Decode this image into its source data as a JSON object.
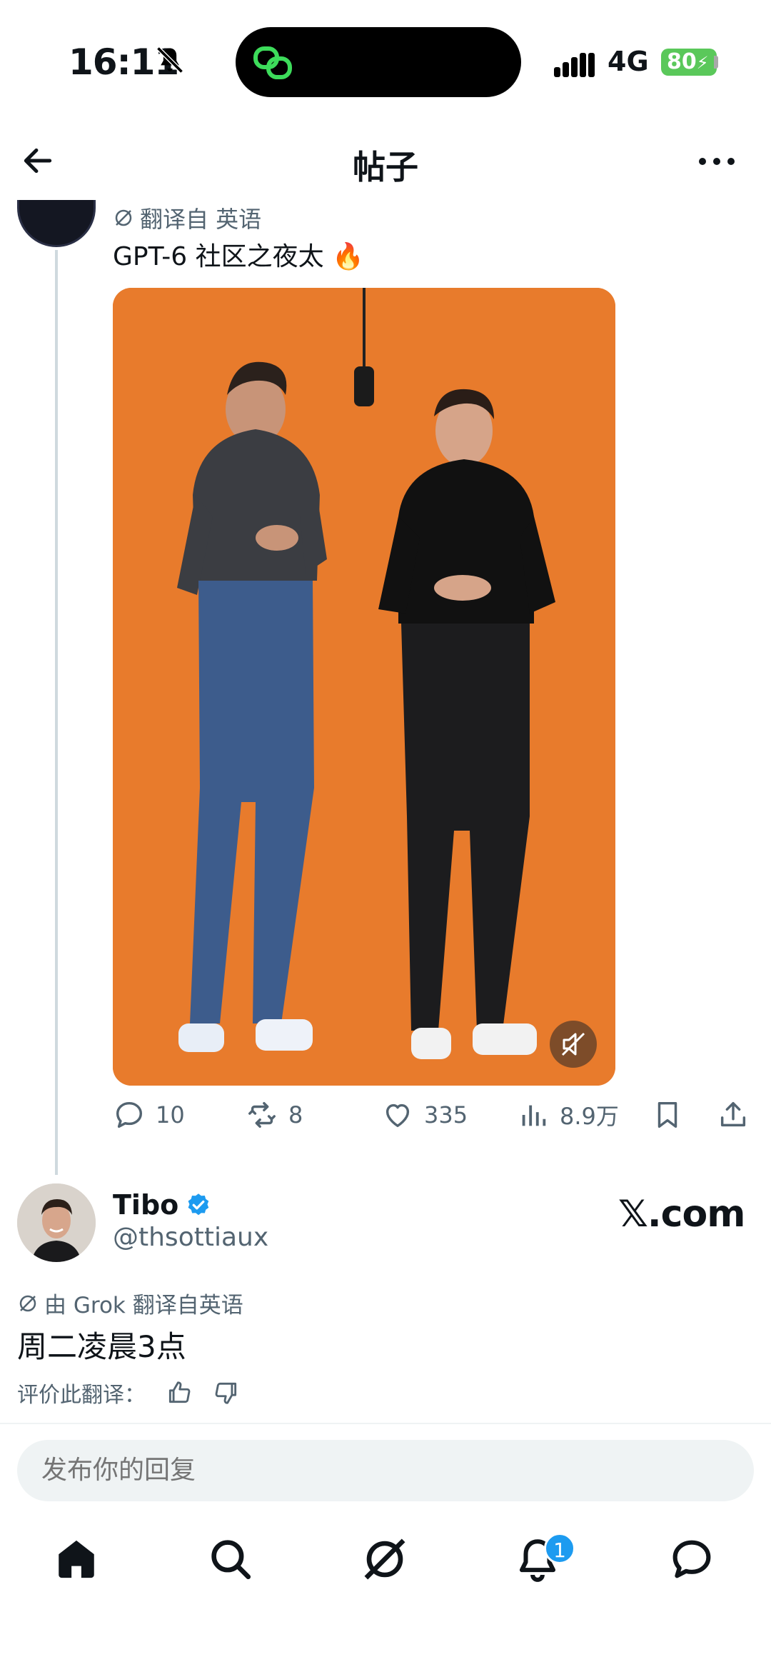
{
  "status_bar": {
    "time": "16:11",
    "network": "4G",
    "battery": "80"
  },
  "header": {
    "title": "帖子"
  },
  "post": {
    "translation_label": "翻译自 英语",
    "text": "GPT-6 社区之夜太 🔥",
    "stats": {
      "replies": "10",
      "reposts": "8",
      "likes": "335",
      "views": "8.9万"
    }
  },
  "reply": {
    "name": "Tibo",
    "handle": "@thsottiaux",
    "badge_text": "𝕏.com",
    "translation_label": "由 Grok 翻译自英语",
    "text": "周二凌晨3点",
    "rate_label": "评价此翻译："
  },
  "composer": {
    "placeholder": "发布你的回复"
  },
  "nav": {
    "notification_count": "1"
  },
  "colors": {
    "accent": "#1d9bf0",
    "secondary_text": "#536471",
    "media_background": "#e87a2a",
    "battery": "#5ac85a"
  },
  "icons": [
    "back-arrow-icon",
    "more-icon",
    "grok-icon",
    "reply-icon",
    "repost-icon",
    "like-icon",
    "views-icon",
    "bookmark-icon",
    "share-icon",
    "verified-icon",
    "thumbs-up-icon",
    "thumbs-down-icon",
    "home-icon",
    "search-icon",
    "grok-nav-icon",
    "notifications-icon",
    "messages-icon",
    "mute-icon"
  ]
}
